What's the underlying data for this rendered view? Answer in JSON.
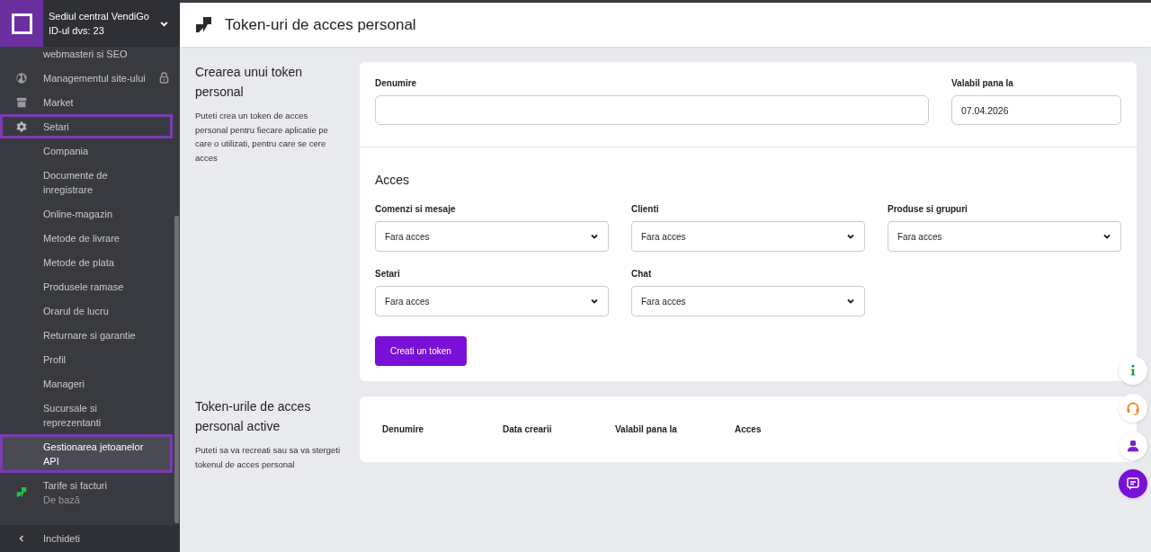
{
  "account": {
    "name": "Sediul central VendiGo",
    "id": "ID-ul dvs: 23"
  },
  "sidebar": {
    "items": [
      {
        "label": "webmasteri si SEO",
        "selected": false,
        "outlined": false,
        "locked": false
      },
      {
        "label": "Managementul site-ului",
        "selected": false,
        "outlined": false,
        "locked": true
      },
      {
        "label": "Market",
        "selected": false,
        "outlined": false,
        "locked": false
      },
      {
        "label": "Setari",
        "selected": false,
        "outlined": true,
        "locked": false
      },
      {
        "label": "Compania",
        "selected": false,
        "outlined": false,
        "locked": false
      },
      {
        "label": "Documente de inregistrare",
        "selected": false,
        "outlined": false,
        "locked": false
      },
      {
        "label": "Online-magazin",
        "selected": false,
        "outlined": false,
        "locked": false
      },
      {
        "label": "Metode de livrare",
        "selected": false,
        "outlined": false,
        "locked": false
      },
      {
        "label": "Metode de plata",
        "selected": false,
        "outlined": false,
        "locked": false
      },
      {
        "label": "Produsele ramase",
        "selected": false,
        "outlined": false,
        "locked": false
      },
      {
        "label": "Orarul de lucru",
        "selected": false,
        "outlined": false,
        "locked": false
      },
      {
        "label": "Returnare si garantie",
        "selected": false,
        "outlined": false,
        "locked": false
      },
      {
        "label": "Profil",
        "selected": false,
        "outlined": false,
        "locked": false
      },
      {
        "label": "Manageri",
        "selected": false,
        "outlined": false,
        "locked": false
      },
      {
        "label": "Sucursale si reprezentanti",
        "selected": false,
        "outlined": false,
        "locked": false
      },
      {
        "label": "Gestionarea jetoanelor API",
        "selected": true,
        "outlined": true,
        "locked": false
      },
      {
        "label": "Tarife si facturi",
        "sublabel": "De bază",
        "selected": false,
        "outlined": false,
        "locked": false
      }
    ],
    "collapse": "Inchideti"
  },
  "page": {
    "title": "Token-uri de acces personal"
  },
  "create": {
    "heading": "Crearea unui token personal",
    "description": "Puteti crea un token de acces personal pentru fiecare aplicatie pe care o utilizati, pentru care se cere acces",
    "name_label": "Denumire",
    "valid_label": "Valabil pana la",
    "valid_value": "07.04.2026",
    "access_heading": "Acces",
    "access": [
      {
        "label": "Comenzi si mesaje",
        "value": "Fara acces"
      },
      {
        "label": "Clienti",
        "value": "Fara acces"
      },
      {
        "label": "Produse si grupuri",
        "value": "Fara acces"
      },
      {
        "label": "Setari",
        "value": "Fara acces"
      },
      {
        "label": "Chat",
        "value": "Fara acces"
      }
    ],
    "button": "Creati un token"
  },
  "active": {
    "heading": "Token-urile de acces personal active",
    "description": "Puteti sa va recreati sau sa va stergeti tokenul de acces personal",
    "columns": [
      "Denumire",
      "Data crearii",
      "Valabil pana la",
      "Acces"
    ]
  }
}
